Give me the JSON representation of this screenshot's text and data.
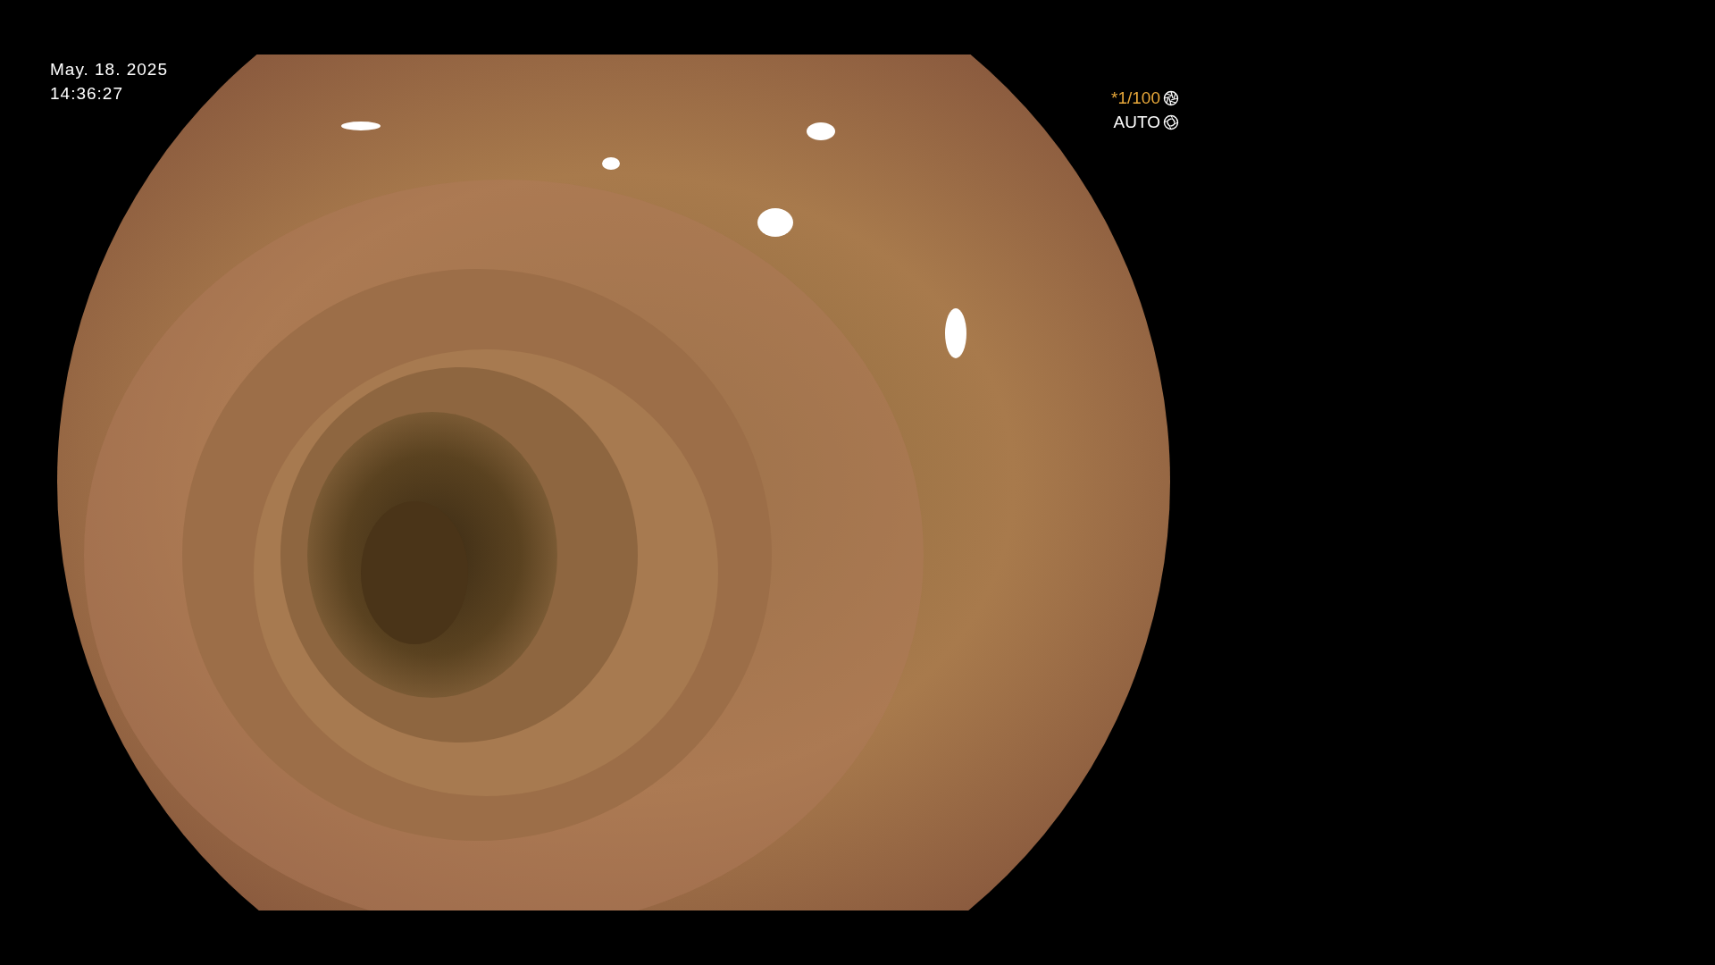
{
  "timestamp": {
    "date": "May. 18. 2025",
    "time": "14:36:27"
  },
  "indicators": [
    {
      "text": "*1/100",
      "color": "#e8a83a",
      "kind": "shutter"
    },
    {
      "text": "AUTO",
      "color": "#ffffff",
      "kind": "iris"
    }
  ]
}
